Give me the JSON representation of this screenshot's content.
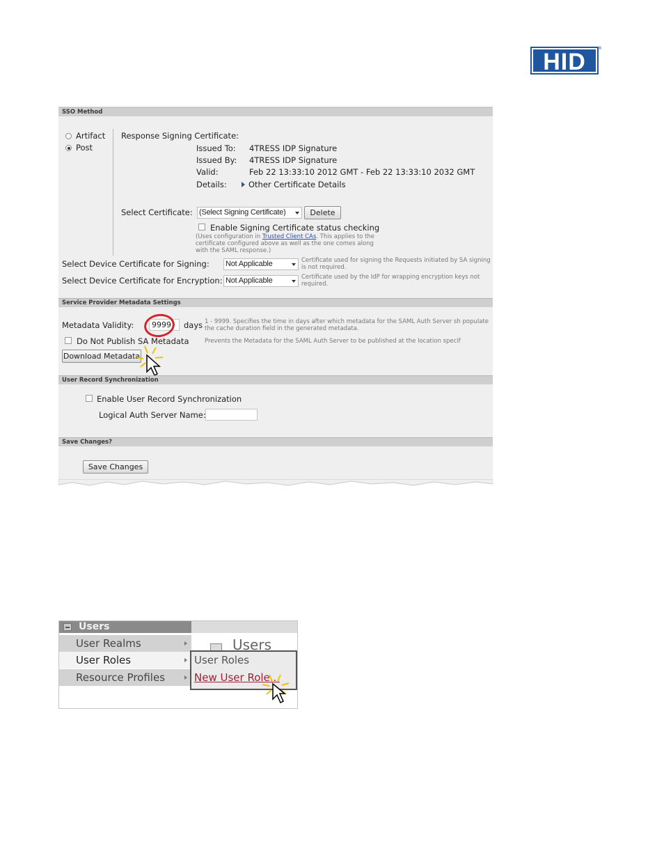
{
  "brand": {
    "logo_text": "HID",
    "registered_mark": "®"
  },
  "sso_method": {
    "section_title": "SSO Method",
    "radio_artifact": "Artifact",
    "radio_post": "Post",
    "selected": "Post",
    "response_signing_label": "Response Signing Certificate:",
    "issued_to_label": "Issued To:",
    "issued_to_value": "4TRESS IDP Signature",
    "issued_by_label": "Issued By:",
    "issued_by_value": "4TRESS IDP Signature",
    "valid_label": "Valid:",
    "valid_value": "Feb 22 13:33:10 2012 GMT - Feb 22 13:33:10 2032 GMT",
    "details_label": "Details:",
    "details_value": "Other Certificate Details",
    "select_cert_label": "Select Certificate:",
    "select_cert_value": "(Select Signing Certificate)",
    "delete_button": "Delete",
    "enable_status_check": "Enable Signing Certificate status checking",
    "status_note_prefix": "(Uses configuration in ",
    "status_note_link": "Trusted Client CAs",
    "status_note_suffix": ". This applies to the certificate configured above as well as the one comes along with the SAML response.)",
    "device_signing_label": "Select Device Certificate for Signing:",
    "device_signing_value": "Not Applicable",
    "device_signing_note": "Certificate used for signing the Requests initiated by SA signing is not required.",
    "device_encryption_label": "Select Device Certificate for Encryption:",
    "device_encryption_value": "Not Applicable",
    "device_encryption_note": "Certificate used by the IdP for wrapping encryption keys not required."
  },
  "metadata": {
    "section_title": "Service Provider Metadata Settings",
    "validity_label": "Metadata Validity:",
    "validity_value": "9999",
    "validity_unit": "days",
    "validity_note": "1 - 9999. Specifies the time in days after which metadata for the SAML Auth Server sh populate the cache duration field in the generated metadata.",
    "no_publish_label": "Do Not Publish SA Metadata",
    "no_publish_note": "Prevents the Metadata for the SAML Auth Server to be published at the location specif",
    "download_button": "Download Metadata"
  },
  "user_sync": {
    "section_title": "User Record Synchronization",
    "enable_label": "Enable User Record Synchronization",
    "logical_name_label": "Logical Auth Server Name:",
    "logical_name_value": ""
  },
  "save": {
    "section_title": "Save Changes?",
    "button": "Save Changes"
  },
  "users_menu": {
    "header": "Users",
    "items": [
      "User Realms",
      "User Roles",
      "Resource Profiles"
    ],
    "page_title": "Users",
    "submenu": [
      "User Roles",
      "New User Role..."
    ]
  },
  "colors": {
    "brand_blue": "#1f56a0",
    "highlight_red": "#d0262f"
  }
}
